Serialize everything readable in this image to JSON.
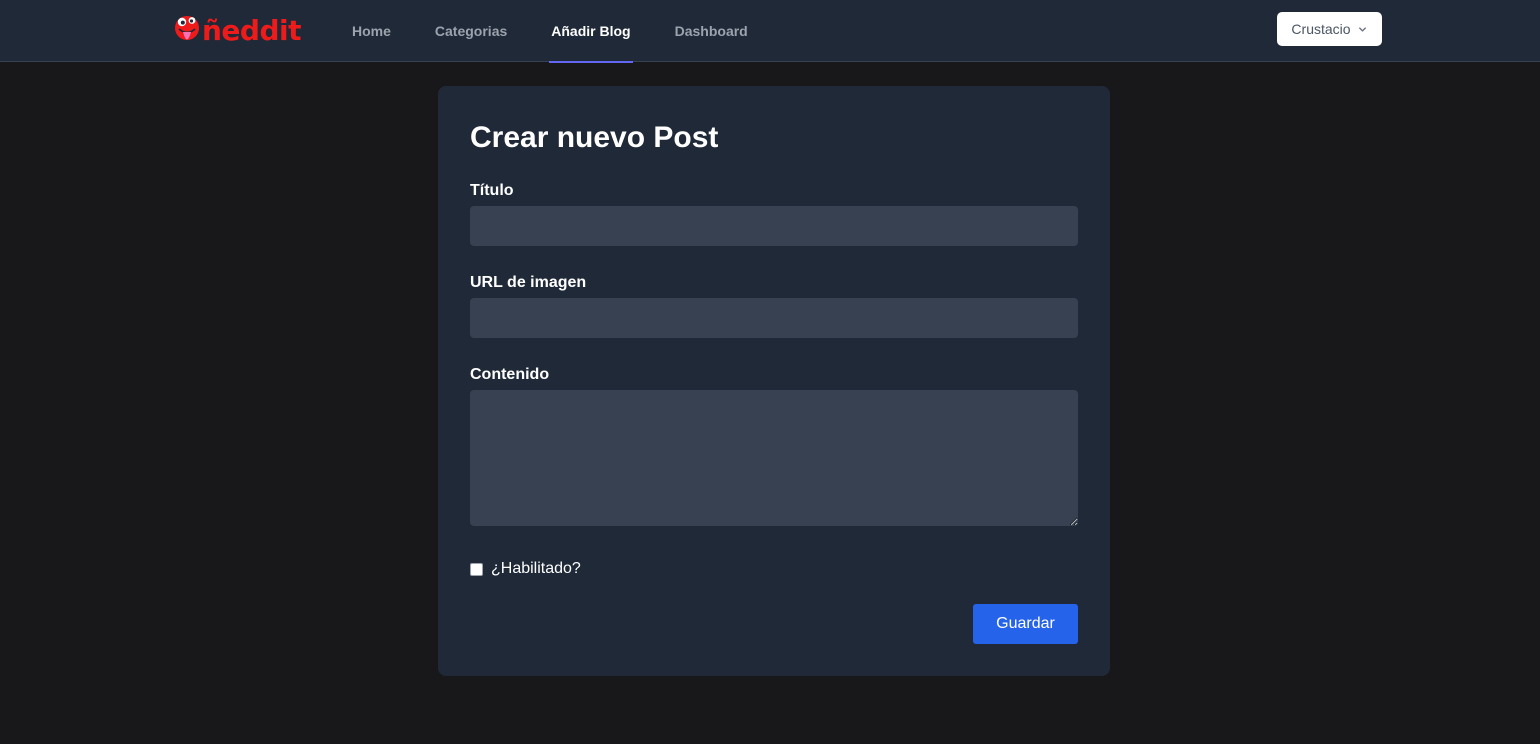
{
  "brand": {
    "name": "ñeddit",
    "color": "#ef1b1b"
  },
  "nav": {
    "items": [
      {
        "label": "Home",
        "active": false
      },
      {
        "label": "Categorias",
        "active": false
      },
      {
        "label": "Añadir Blog",
        "active": true
      },
      {
        "label": "Dashboard",
        "active": false
      }
    ],
    "active_indicator_color": "#6366f1"
  },
  "user_menu": {
    "label": "Crustacio",
    "icon": "chevron-down-icon"
  },
  "form": {
    "title": "Crear nuevo Post",
    "fields": {
      "title": {
        "label": "Título",
        "value": "",
        "placeholder": ""
      },
      "image_url": {
        "label": "URL de imagen",
        "value": "",
        "placeholder": ""
      },
      "content": {
        "label": "Contenido",
        "value": "",
        "placeholder": ""
      }
    },
    "enabled_checkbox": {
      "label": "¿Habilitado?",
      "checked": false
    },
    "submit_label": "Guardar",
    "submit_color": "#2563eb"
  },
  "colors": {
    "page_background": "#18181b",
    "surface": "#1f2937",
    "input_background": "#374151"
  }
}
